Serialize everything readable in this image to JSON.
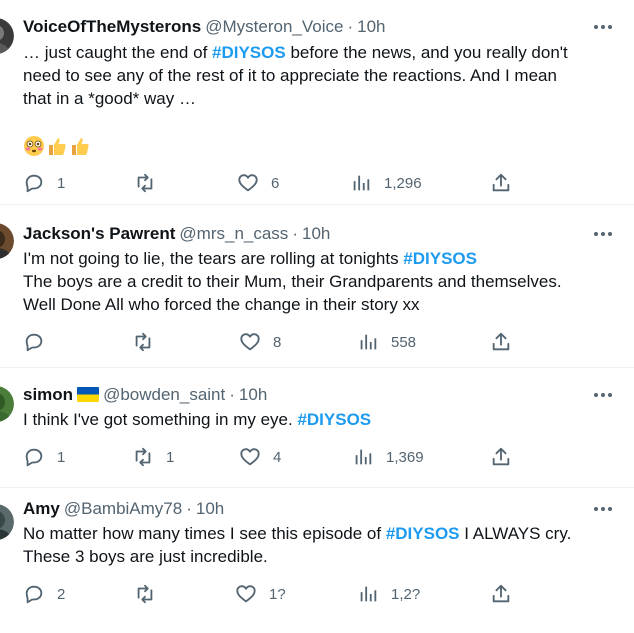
{
  "tweets": [
    {
      "name": "VoiceOfTheMysterons",
      "handle": "@Mysteron_Voice",
      "time": "10h",
      "line1_pre": "… just caught the end of ",
      "line1_tag": "#DIYSOS",
      "line1_post": " before the news, and you really don't",
      "line2": "need to see any of the rest of it to appreciate the reactions. And I mean",
      "line3": "that in a *good* way …",
      "emojis": [
        "flushed-face",
        "thumbs-up",
        "thumbs-up"
      ],
      "replies": "1",
      "retweets": "",
      "likes": "6",
      "views": "1,296"
    },
    {
      "name": "Jackson's Pawrent",
      "handle": "@mrs_n_cass",
      "time": "10h",
      "line1_pre": "I'm not going to lie, the tears are rolling at tonights ",
      "line1_tag": "#DIYSOS",
      "line2": "The boys are a credit to their Mum, their Grandparents and themselves.",
      "line3": "Well Done All who forced the change in their story xx",
      "replies": "",
      "retweets": "",
      "likes": "8",
      "views": "558"
    },
    {
      "name": "simon",
      "flag": "ukraine-flag",
      "handle": "@bowden_saint",
      "time": "10h",
      "line1_pre": "I think I've got something in my eye. ",
      "line1_tag": "#DIYSOS",
      "replies": "1",
      "retweets": "1",
      "likes": "4",
      "views": "1,369"
    },
    {
      "name": "Amy",
      "handle": "@BambiAmy78",
      "time": "10h",
      "line1_pre": "No matter how many times I see this episode  of ",
      "line1_tag": "#DIYSOS",
      "line1_post": " I ALWAYS cry.",
      "line2": "These 3 boys are just incredible.",
      "replies": "2",
      "retweets": "",
      "likes": "1?",
      "views": "1,2?"
    }
  ],
  "separator": "·",
  "colors": {
    "text": "#0f1419",
    "muted": "#536471",
    "hashtag": "#1d9bf0",
    "divider": "#eff3f4",
    "flag_blue": "#0057b7",
    "flag_yellow": "#ffd700"
  }
}
